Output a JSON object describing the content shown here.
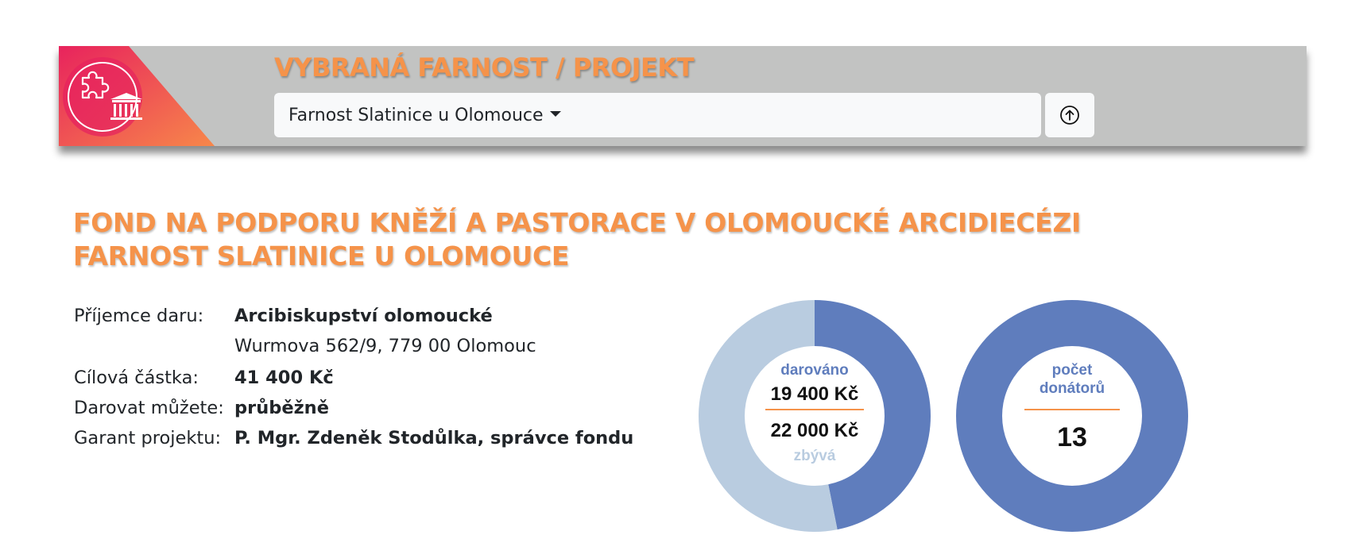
{
  "header": {
    "title": "VYBRANÁ FARNOST / PROJEKT",
    "selected_parish": "Farnost Slatinice u Olomouce",
    "icons": {
      "logo": "puzzle-church-logo-icon",
      "dropdown": "caret-down-icon",
      "up": "arrow-up-circle-icon"
    },
    "colors": {
      "banner_bg": "#c2c3c2",
      "accent_orange": "#f5934a",
      "logo_gradient_start": "#e8235d",
      "logo_gradient_end": "#f7874a"
    }
  },
  "project": {
    "title_line1": "FOND NA PODPORU KNĚŽÍ A PASTORACE V OLOMOUCKÉ ARCIDIECÉZI",
    "title_line2": "FARNOST SLATINICE U OLOMOUCE"
  },
  "details": {
    "recipient_label": "Příjemce daru:",
    "recipient_name": "Arcibiskupství olomoucké",
    "recipient_address": "Wurmova 562/9, 779 00 Olomouc",
    "target_label": "Cílová částka:",
    "target_value": "41 400 Kč",
    "donate_label": "Darovat můžete:",
    "donate_value": "průběžně",
    "guarantor_label": "Garant projektu:",
    "guarantor_value": "P. Mgr. Zdeněk Stodůlka, správce fondu"
  },
  "donation_chart": {
    "donated_label": "darováno",
    "donated_value": "19 400 Kč",
    "remaining_value": "22 000 Kč",
    "remaining_label": "zbývá"
  },
  "donors_chart": {
    "label": "počet donátorů",
    "label_line1": "počet",
    "label_line2": "donátorů",
    "value": "13"
  },
  "chart_data": [
    {
      "type": "pie",
      "categories": [
        "darováno",
        "zbývá"
      ],
      "values": [
        19400,
        22000
      ],
      "colors": [
        "#5f7dbd",
        "#b9cce0"
      ],
      "donut": true
    },
    {
      "type": "pie",
      "categories": [
        "počet donátorů"
      ],
      "values": [
        13
      ],
      "colors": [
        "#5f7dbd"
      ],
      "donut": true
    }
  ]
}
